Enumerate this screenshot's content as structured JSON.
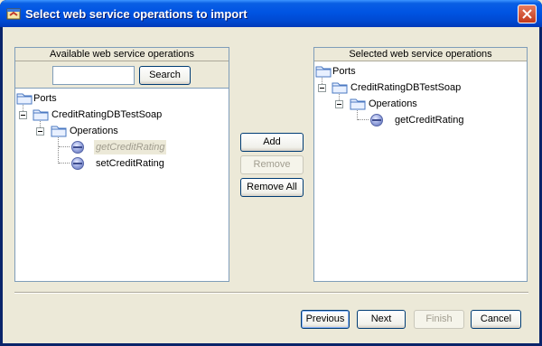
{
  "window": {
    "title": "Select web service operations to import",
    "icon": "import-wizard-icon",
    "close_icon": "close-icon"
  },
  "available_panel": {
    "header": "Available web service operations",
    "search": {
      "value": "",
      "placeholder": "",
      "button_label": "Search"
    },
    "tree": {
      "root": "Ports",
      "port": "CreditRatingDBTestSoap",
      "folder": "Operations",
      "operations": [
        {
          "label": "getCreditRating",
          "state": "disabled"
        },
        {
          "label": "setCreditRating",
          "state": "normal"
        }
      ]
    }
  },
  "middle_buttons": {
    "add": "Add",
    "remove": "Remove",
    "remove_all": "Remove All"
  },
  "selected_panel": {
    "header": "Selected web service operations",
    "tree": {
      "root": "Ports",
      "port": "CreditRatingDBTestSoap",
      "folder": "Operations",
      "operations": [
        {
          "label": "getCreditRating"
        }
      ]
    }
  },
  "footer": {
    "previous": "Previous",
    "next": "Next",
    "finish": "Finish",
    "cancel": "Cancel"
  },
  "colors": {
    "titlebar": "#0054e3",
    "dialog_bg": "#ece9d8",
    "panel_border": "#7f9db9",
    "disabled_text": "#a19d8f"
  }
}
